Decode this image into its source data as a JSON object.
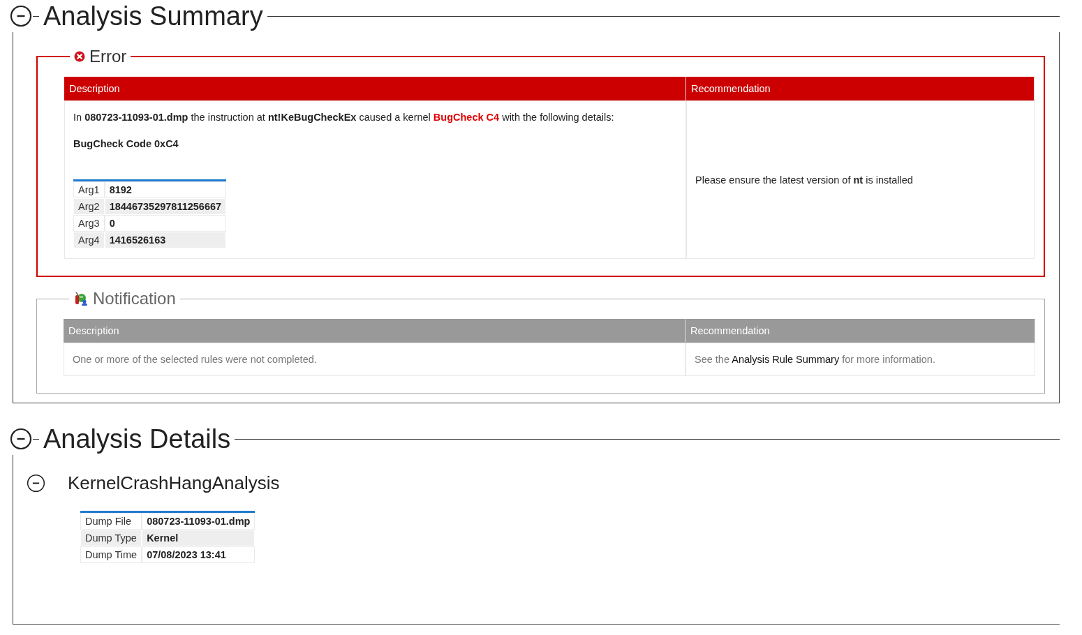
{
  "sections": [
    {
      "title": "Analysis Summary",
      "expanded": true,
      "groups": [
        {
          "kind": "error",
          "title": "Error",
          "columns": [
            "Description",
            "Recommendation"
          ],
          "rows": [
            {
              "description": [
                {
                  "kind": "plain",
                  "text": "In "
                },
                {
                  "kind": "bold",
                  "text": "080723-11093-01.dmp"
                },
                {
                  "kind": "plain",
                  "text": " the instruction at "
                },
                {
                  "kind": "bold",
                  "text": "nt!KeBugCheckEx"
                },
                {
                  "kind": "plain",
                  "text": " caused a kernel "
                },
                {
                  "kind": "alert",
                  "text": "BugCheck C4"
                },
                {
                  "kind": "plain",
                  "text": " with the following details:"
                }
              ],
              "code": "BugCheck Code 0xC4",
              "args": [
                {
                  "label": "Arg1",
                  "value": "8192"
                },
                {
                  "label": "Arg2",
                  "value": "18446735297811256667"
                },
                {
                  "label": "Arg3",
                  "value": "0"
                },
                {
                  "label": "Arg4",
                  "value": "1416526163"
                }
              ],
              "recommendation": [
                {
                  "kind": "plain",
                  "text": "Please ensure the latest version of "
                },
                {
                  "kind": "bold",
                  "text": "nt"
                },
                {
                  "kind": "plain",
                  "text": " is installed"
                }
              ]
            }
          ]
        },
        {
          "kind": "notification",
          "title": "Notification",
          "columns": [
            "Description",
            "Recommendation"
          ],
          "rows": [
            {
              "description": [
                {
                  "kind": "plain",
                  "text": "One or more of the selected rules were not completed."
                }
              ],
              "recommendation": [
                {
                  "kind": "plain",
                  "text": "See the "
                },
                {
                  "kind": "link",
                  "text": "Analysis Rule Summary"
                },
                {
                  "kind": "plain",
                  "text": " for more information."
                }
              ]
            }
          ]
        }
      ]
    },
    {
      "title": "Analysis Details",
      "expanded": true,
      "subsections": [
        {
          "title": "KernelCrashHangAnalysis",
          "expanded": true,
          "properties": [
            {
              "label": "Dump File",
              "value": "080723-11093-01.dmp"
            },
            {
              "label": "Dump Type",
              "value": "Kernel"
            },
            {
              "label": "Dump Time",
              "value": "07/08/2023 13:41"
            }
          ]
        }
      ]
    }
  ]
}
